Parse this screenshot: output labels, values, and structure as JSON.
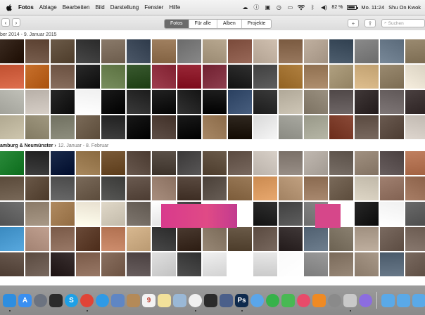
{
  "menubar": {
    "app_name": "Fotos",
    "items": [
      "Ablage",
      "Bearbeiten",
      "Bild",
      "Darstellung",
      "Fenster",
      "Hilfe"
    ],
    "battery_text": "82 %",
    "battery_level": 0.82,
    "clock": "Mo. 11:24",
    "user_name": "Shu On Kwok",
    "status_icons": [
      "cloud-icon",
      "info-icon",
      "app-icon",
      "timemachine-icon",
      "airplay-icon",
      "wifi-icon",
      "bluetooth-icon",
      "volume-icon"
    ]
  },
  "toolbar": {
    "back_glyph": "‹",
    "forward_glyph": "›",
    "tabs": [
      {
        "label": "Fotos",
        "selected": true
      },
      {
        "label": "Für alle",
        "selected": false
      },
      {
        "label": "Alben",
        "selected": false
      },
      {
        "label": "Projekte",
        "selected": false
      }
    ],
    "add_glyph": "+",
    "share_glyph": "⇪",
    "search_placeholder": "Suchen"
  },
  "sections": [
    {
      "location": "",
      "date": "ber 2014 - 9. Januar 2015"
    },
    {
      "location": "amburg & Neumünster ›",
      "date": "12. Januar - 8. Februar"
    }
  ],
  "dock": {
    "apps": [
      {
        "name": "finder",
        "color": "#2e8ee0",
        "letter": "",
        "running": true
      },
      {
        "name": "app-store",
        "color": "#3a8ff0",
        "letter": "A",
        "running": false
      },
      {
        "name": "launchpad",
        "color": "#6c7380",
        "letter": "",
        "running": false
      },
      {
        "name": "mission-control",
        "color": "#2b2b2b",
        "letter": "",
        "running": false
      },
      {
        "name": "skype",
        "color": "#1ea0e6",
        "letter": "S",
        "running": false
      },
      {
        "name": "chrome",
        "color": "#e04437",
        "letter": "",
        "running": true
      },
      {
        "name": "safari",
        "color": "#2f9ae6",
        "letter": "",
        "running": false
      },
      {
        "name": "preview",
        "color": "#5f86c4",
        "letter": "",
        "running": false
      },
      {
        "name": "contacts",
        "color": "#b48a58",
        "letter": "",
        "running": false
      },
      {
        "name": "calendar",
        "color": "#f3f3f3",
        "letter": "9",
        "running": false
      },
      {
        "name": "notes",
        "color": "#f2e19a",
        "letter": "",
        "running": false
      },
      {
        "name": "preview-2",
        "color": "#9ab8d6",
        "letter": "",
        "running": false
      },
      {
        "name": "photos",
        "color": "#f0f0f0",
        "letter": "",
        "running": true
      },
      {
        "name": "final-cut",
        "color": "#2b2b2b",
        "letter": "",
        "running": false
      },
      {
        "name": "pixelmator",
        "color": "#4a5f8a",
        "letter": "",
        "running": false
      },
      {
        "name": "photoshop",
        "color": "#0e2a4d",
        "letter": "Ps",
        "running": true
      },
      {
        "name": "messages-blue",
        "color": "#5aa6ea",
        "letter": "",
        "running": false
      },
      {
        "name": "facetime",
        "color": "#36b24a",
        "letter": "",
        "running": false
      },
      {
        "name": "messages",
        "color": "#48b953",
        "letter": "",
        "running": false
      },
      {
        "name": "itunes",
        "color": "#e94b6a",
        "letter": "",
        "running": false
      },
      {
        "name": "ibooks",
        "color": "#ef8a23",
        "letter": "",
        "running": false
      },
      {
        "name": "system-preferences",
        "color": "#8a8a8a",
        "letter": "",
        "running": false
      },
      {
        "name": "script-editor",
        "color": "#c9c9c9",
        "letter": "",
        "running": true
      },
      {
        "name": "onepassword",
        "color": "#8c6de0",
        "letter": "",
        "running": false
      }
    ],
    "folders": [
      {
        "name": "applications-folder",
        "color": "#5aa9e8"
      },
      {
        "name": "documents-folder",
        "color": "#5aa9e8"
      },
      {
        "name": "downloads-folder",
        "color": "#5aa9e8"
      },
      {
        "name": "trash",
        "color": "#b8c4cc"
      }
    ]
  }
}
